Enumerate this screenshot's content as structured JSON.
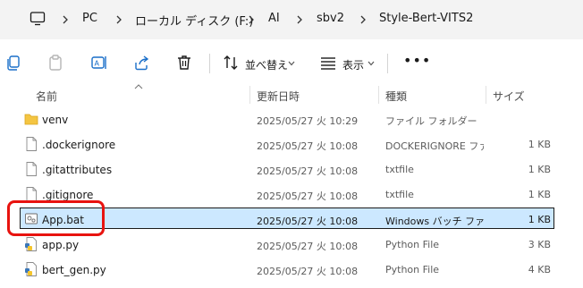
{
  "address": {
    "icon": "monitor-icon",
    "crumbs": [
      "PC",
      "ローカル ディスク (F:)",
      "AI",
      "sbv2",
      "Style-Bert-VITS2"
    ]
  },
  "toolbar": {
    "sort_label": "並べ替え",
    "view_label": "表示",
    "more_label": "•••"
  },
  "columns": {
    "name": "名前",
    "date": "更新日時",
    "type": "種類",
    "size": "サイズ"
  },
  "files": [
    {
      "name": "venv",
      "date": "2025/05/27 火 10:29",
      "type": "ファイル フォルダー",
      "size": "",
      "icon": "folder-icon"
    },
    {
      "name": ".dockerignore",
      "date": "2025/05/27 火 10:08",
      "type": "DOCKERIGNORE ファ...",
      "size": "1 KB",
      "icon": "file-icon"
    },
    {
      "name": ".gitattributes",
      "date": "2025/05/27 火 10:08",
      "type": "txtfile",
      "size": "1 KB",
      "icon": "file-icon"
    },
    {
      "name": ".gitignore",
      "date": "2025/05/27 火 10:08",
      "type": "txtfile",
      "size": "1 KB",
      "icon": "file-icon"
    },
    {
      "name": "App.bat",
      "date": "2025/05/27 火 10:08",
      "type": "Windows バッチ ファ...",
      "size": "1 KB",
      "icon": "batch-file-icon",
      "selected": true
    },
    {
      "name": "app.py",
      "date": "2025/05/27 火 10:08",
      "type": "Python File",
      "size": "3 KB",
      "icon": "python-file-icon"
    },
    {
      "name": "bert_gen.py",
      "date": "2025/05/27 火 10:08",
      "type": "Python File",
      "size": "4 KB",
      "icon": "python-file-icon"
    }
  ],
  "colors": {
    "selection_bg": "#cce8ff",
    "highlight_box": "#e8130f",
    "folder": "#f4c542"
  }
}
